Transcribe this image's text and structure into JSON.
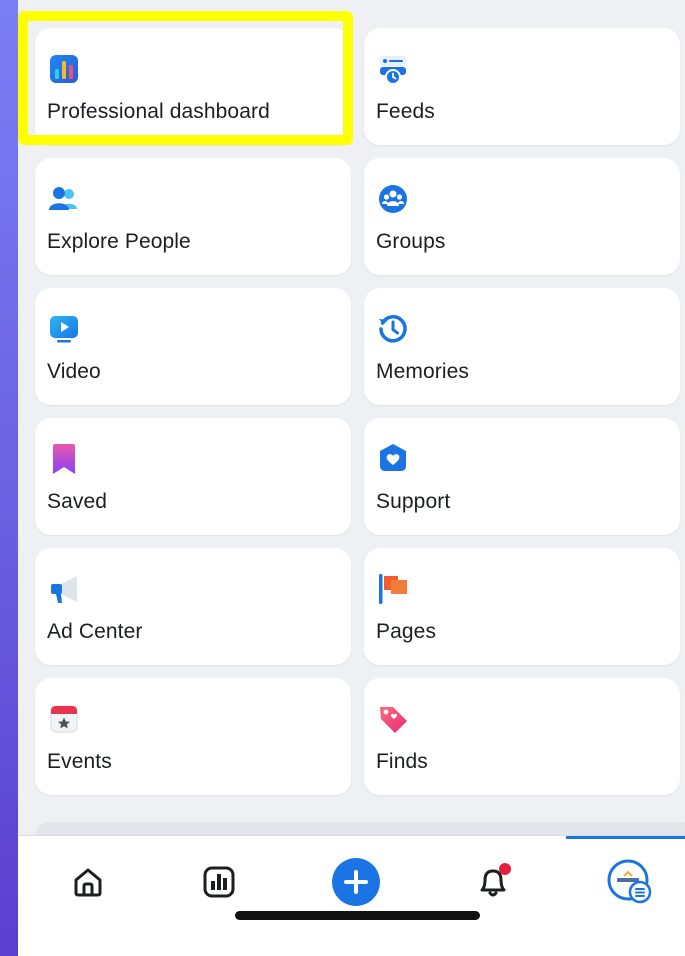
{
  "menu": {
    "tiles": [
      {
        "label": "Professional dashboard",
        "icon": "professional-dashboard-icon"
      },
      {
        "label": "Feeds",
        "icon": "feeds-icon"
      },
      {
        "label": "Explore People",
        "icon": "explore-people-icon"
      },
      {
        "label": "Groups",
        "icon": "groups-icon"
      },
      {
        "label": "Video",
        "icon": "video-icon"
      },
      {
        "label": "Memories",
        "icon": "memories-icon"
      },
      {
        "label": "Saved",
        "icon": "saved-icon"
      },
      {
        "label": "Support",
        "icon": "support-icon"
      },
      {
        "label": "Ad Center",
        "icon": "ad-center-icon"
      },
      {
        "label": "Pages",
        "icon": "pages-icon"
      },
      {
        "label": "Events",
        "icon": "events-icon"
      },
      {
        "label": "Finds",
        "icon": "finds-icon"
      }
    ]
  },
  "highlight": {
    "color": "#ffff00",
    "target": "Professional dashboard"
  },
  "tabbar": {
    "tabs": [
      {
        "icon": "home-icon"
      },
      {
        "icon": "dashboard-icon"
      },
      {
        "icon": "create-plus-icon"
      },
      {
        "icon": "notifications-bell-icon",
        "has_badge": true
      },
      {
        "icon": "profile-menu-icon",
        "active": true
      }
    ],
    "accent": "#1b74e4",
    "badge_color": "#e41e3f"
  }
}
